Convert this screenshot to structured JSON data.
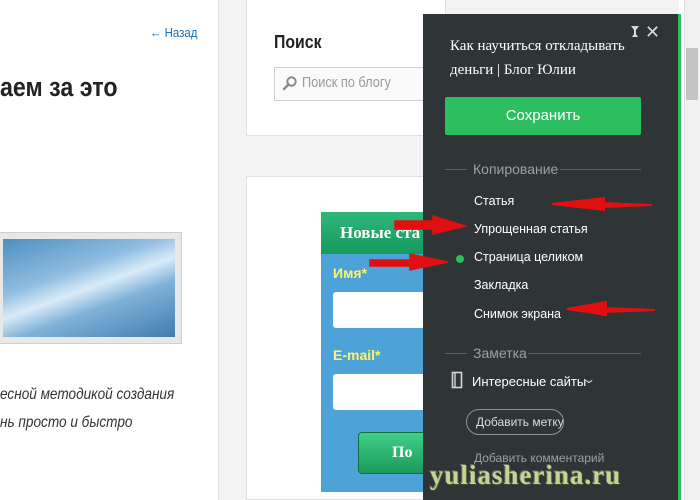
{
  "left": {
    "back_link": "← Назад",
    "heading": "аем за это",
    "excerpt_line1": "есной методикой создания",
    "excerpt_line2": "нь просто и быстро"
  },
  "search_widget": {
    "title": "Поиск",
    "placeholder": "Поиск по блогу"
  },
  "subscribe_widget": {
    "title": "Новые ста",
    "name_label": "Имя*",
    "email_label": "E-mail*",
    "submit_label": "По"
  },
  "clipper": {
    "title_line1": "Как научиться откладывать",
    "title_line2": "деньги | Блог Юлии",
    "save_label": "Сохранить",
    "copy_section_title": "Копирование",
    "clip_options": [
      "Статья",
      "Упрощенная статья",
      "Страница целиком",
      "Закладка",
      "Снимок экрана"
    ],
    "selected_option": "Страница целиком",
    "note_section_title": "Заметка",
    "notebook": "Интересные сайты",
    "add_tag_label": "Добавить метку",
    "add_comment_label": "Добавить комментарий",
    "accent_color": "#2dbe60",
    "panel_color": "#2f3437"
  },
  "watermark": "yuliasherina.ru",
  "annotation_color": "#e01010"
}
